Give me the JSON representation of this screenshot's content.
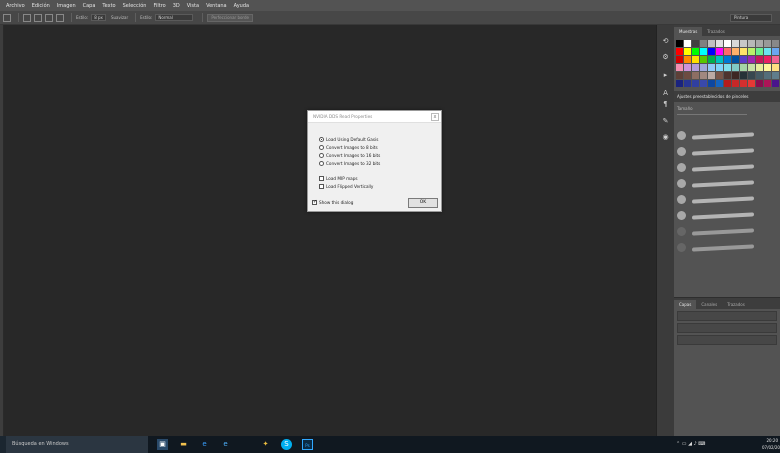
{
  "menu": [
    "Archivo",
    "Edición",
    "Imagen",
    "Capa",
    "Texto",
    "Selección",
    "Filtro",
    "3D",
    "Vista",
    "Ventana",
    "Ayuda"
  ],
  "options": {
    "size_label": "Estilo:",
    "size_value": "8 px",
    "smooth_label": "Suavizar",
    "mode_label": "Estilo:",
    "mode_value": "Normal",
    "refine_button": "Perfeccionar borde",
    "search_value": "Pintura"
  },
  "panels": {
    "tab_swatches": "Muestras",
    "tab_adjust": "Trazados",
    "brushes_title": "Ajustes preestablecidos de pinceles",
    "brush_size_label": "Tamaño",
    "layers_tab": "Capas",
    "channels_tab": "Canales",
    "paths_tab": "Trazados"
  },
  "swatch_colors": [
    "#000000",
    "#ffffff",
    "#404040",
    "#808080",
    "#c0c0c0",
    "#e0e0e0",
    "#ffffff",
    "#d8d8d8",
    "#c8c8c8",
    "#b8b8b8",
    "#a8a8a8",
    "#989898",
    "#888888",
    "#787878",
    "#ff0000",
    "#ffff00",
    "#00ff00",
    "#00ffff",
    "#0000ff",
    "#ff00ff",
    "#ff6a6a",
    "#ffb06a",
    "#ffe36a",
    "#b9f06a",
    "#6af08f",
    "#6ae3f0",
    "#6aa6f0",
    "#a46af0",
    "#d40000",
    "#ff8a00",
    "#ffe000",
    "#58c800",
    "#00b050",
    "#00c0c0",
    "#0078d4",
    "#0050a0",
    "#5a3cc8",
    "#9c27b0",
    "#c2185b",
    "#e91e63",
    "#f06292",
    "#ffab91",
    "#f48fb1",
    "#ce93d8",
    "#b39ddb",
    "#9fa8da",
    "#90caf9",
    "#81d4fa",
    "#80deea",
    "#80cbc4",
    "#a5d6a7",
    "#c5e1a5",
    "#e6ee9c",
    "#fff59d",
    "#ffe082",
    "#ffcc80",
    "#5d4037",
    "#6d4c41",
    "#8d6e63",
    "#a1887f",
    "#bcaaa4",
    "#795548",
    "#4e342e",
    "#3e2723",
    "#263238",
    "#37474f",
    "#455a64",
    "#546e7a",
    "#607d8b",
    "#78909c",
    "#1a237e",
    "#283593",
    "#303f9f",
    "#3949ab",
    "#0d47a1",
    "#1565c0",
    "#b71c1c",
    "#c62828",
    "#d32f2f",
    "#e53935",
    "#880e4f",
    "#ad1457",
    "#4a148c",
    "#6a1b9a"
  ],
  "dialog": {
    "title": "NVIDIA DDS Read Properties",
    "close": "x",
    "options": [
      "Load Using Default Gasis",
      "Convert Images to 8 bits",
      "Convert Images to 16 bits",
      "Convert Images to 32 bits"
    ],
    "selected_index": 0,
    "checks": [
      "Load MIP maps",
      "Load Flipped Vertically"
    ],
    "show_label": "Show this dialog",
    "ok_label": "OK"
  },
  "taskbar": {
    "search_placeholder": "Búsqueda en Windows",
    "tray": "⌃ ▭ ◢ ♪ ⌨",
    "time": "20:20",
    "date": "07/02/2018"
  }
}
